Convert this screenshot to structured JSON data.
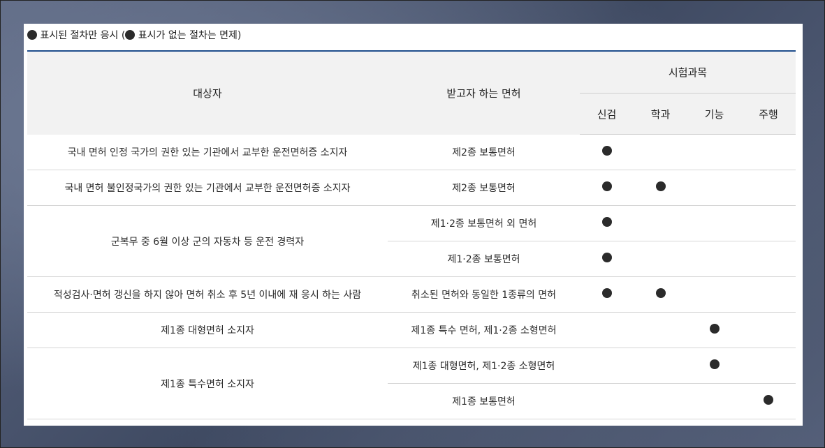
{
  "note": {
    "symbol": "●",
    "text_before": "표시된 절차만 응시 (",
    "text_after": "표시가 없는 절차는 면제)"
  },
  "header": {
    "target": "대상자",
    "license": "받고자 하는 면허",
    "subjects": "시험과목",
    "subject_names": [
      "신검",
      "학과",
      "기능",
      "주행"
    ]
  },
  "rows": [
    {
      "target": "국내 면허 인정 국가의 권한 있는 기관에서 교부한 운전면허증 소지자",
      "license": "제2종 보통면허",
      "marks": [
        true,
        false,
        false,
        false
      ]
    },
    {
      "target": "국내 면허 불인정국가의 권한 있는 기관에서 교부한 운전면허증 소지자",
      "license": "제2종 보통면허",
      "marks": [
        true,
        true,
        false,
        false
      ]
    },
    {
      "target": "군복무 중 6월 이상 군의 자동차 등 운전 경력자",
      "license": "제1·2종 보통면허 외 면허",
      "marks": [
        true,
        false,
        false,
        false
      ]
    },
    {
      "target": "",
      "license": "제1·2종 보통면허",
      "marks": [
        true,
        false,
        false,
        false
      ]
    },
    {
      "target": "적성검사·면허 갱신을 하지 않아 면허 취소 후 5년 이내에 재 응시 하는 사람",
      "license": "취소된 면허와 동일한 1종류의 면허",
      "marks": [
        true,
        true,
        false,
        false
      ]
    },
    {
      "target": "제1종 대형면허 소지자",
      "license": "제1종 특수 면허, 제1·2종 소형면허",
      "marks": [
        false,
        false,
        true,
        false
      ]
    },
    {
      "target": "제1종 특수면허 소지자",
      "license": "제1종 대형면허, 제1·2종 소형면허",
      "marks": [
        false,
        false,
        true,
        false
      ]
    },
    {
      "target": "",
      "license": "제1종 보통면허",
      "marks": [
        false,
        false,
        false,
        true
      ]
    }
  ]
}
